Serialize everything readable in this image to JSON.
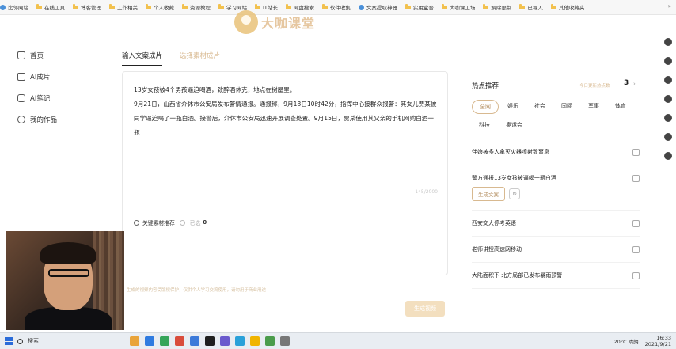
{
  "bookmarks": {
    "items": [
      {
        "label": "比邻网站",
        "kind": "site"
      },
      {
        "label": "在线工具",
        "kind": "folder"
      },
      {
        "label": "博客管理",
        "kind": "folder"
      },
      {
        "label": "工作相关",
        "kind": "folder"
      },
      {
        "label": "个人收藏",
        "kind": "folder"
      },
      {
        "label": "资源教程",
        "kind": "folder"
      },
      {
        "label": "学习网站",
        "kind": "folder"
      },
      {
        "label": "IT站长",
        "kind": "folder"
      },
      {
        "label": "网盘搜索",
        "kind": "folder"
      },
      {
        "label": "软件收集",
        "kind": "folder"
      },
      {
        "label": "文案提取神器",
        "kind": "site"
      },
      {
        "label": "实用盒合",
        "kind": "folder"
      },
      {
        "label": "大咖课工场",
        "kind": "folder"
      },
      {
        "label": "解除限制",
        "kind": "folder"
      },
      {
        "label": "已导入",
        "kind": "folder"
      },
      {
        "label": "其他收藏夹",
        "kind": "folder"
      }
    ],
    "more": "»"
  },
  "logo": {
    "text": "大咖课堂"
  },
  "nav": {
    "items": [
      {
        "label": "首页",
        "icon": "home-icon"
      },
      {
        "label": "AI成片",
        "icon": "ai-film-icon"
      },
      {
        "label": "AI笔记",
        "icon": "ai-note-icon"
      },
      {
        "label": "我的作品",
        "icon": "works-icon"
      }
    ]
  },
  "tabs": [
    {
      "label": "输入文案成片",
      "active": true
    },
    {
      "label": "选择素材成片",
      "active": false
    }
  ],
  "editor": {
    "paragraphs": [
      "13岁女孩被4个男孩逼迫喝酒，致醉酒休克，地点在树屋里。",
      "9月21日，山西省介休市公安局发布警情通报。通报称，9月18日10时42分，指挥中心接群众报警：其女儿贾某被同学逼迫喝了一瓶白酒。接警后，介休市公安局迅速开展调查处置。9月15日，贾某使用其父亲的手机网购白酒一瓶"
    ],
    "word_count": "145/2000",
    "keyword_label": "关键素材推荐",
    "keyword_selected_label": "已选",
    "keyword_count": "0"
  },
  "hint": "生成的视频内容受版权保护，仅供个人学习交流使用，请勿用于商业用途",
  "generate_button": "生成视频",
  "hot": {
    "title": "热点推荐",
    "link": "今日更新热点数",
    "count": "3",
    "categories": [
      "全网",
      "娱乐",
      "社会",
      "国际",
      "军事",
      "体育",
      "科技",
      "奥运会"
    ],
    "items": [
      {
        "title": "伴娘被多人拿灭火器喷射致窒息"
      },
      {
        "title": "警方通报13岁女孩被逼喝一瓶白酒",
        "expanded": true
      },
      {
        "title": "西安交大停考英语"
      },
      {
        "title": "老师讲授高速网移动"
      },
      {
        "title": "大陆面积下 北方局部已发布暴雨预警"
      }
    ],
    "action_generate": "生成文案",
    "action_refresh_icon": "refresh-icon"
  },
  "taskbar": {
    "search_label": "搜索",
    "weather": "20°C 晴朗",
    "time": "16:33",
    "date": "2021/9/21",
    "apps": [
      "#e9a43a",
      "#2f7be0",
      "#36a55a",
      "#d94c3b",
      "#3c7ad9",
      "#1f1f1f",
      "#6a5acd",
      "#2aa1d9",
      "#f0b400",
      "#4b9c4b",
      "#777777"
    ]
  }
}
